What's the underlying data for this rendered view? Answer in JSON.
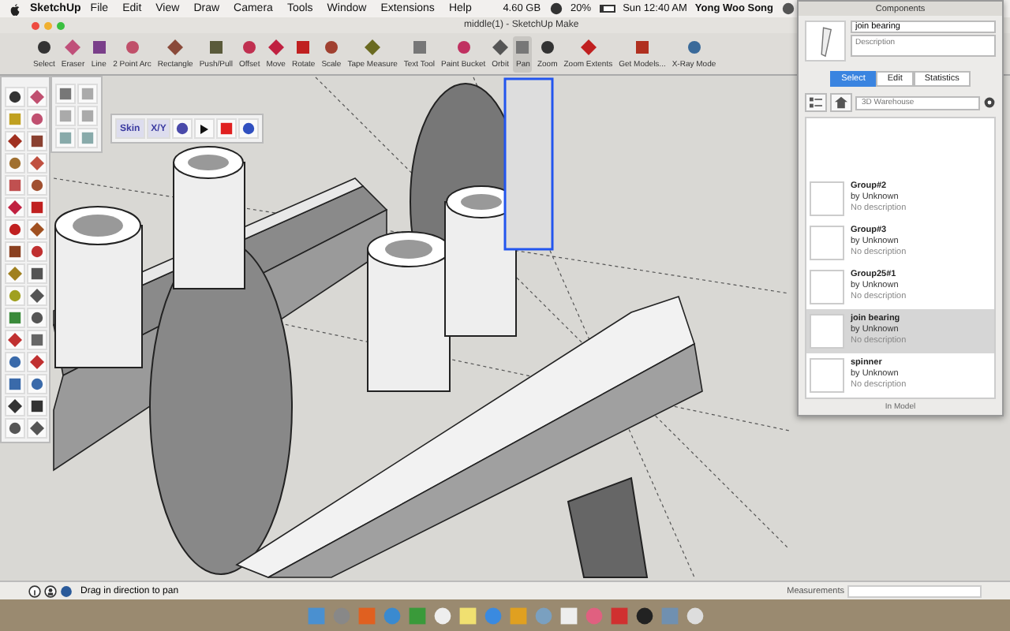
{
  "menu_bar": {
    "app": "SketchUp",
    "items": [
      "File",
      "Edit",
      "View",
      "Draw",
      "Camera",
      "Tools",
      "Window",
      "Extensions",
      "Help"
    ],
    "status": {
      "memory": "4.60 GB",
      "battery": "20%",
      "clock": "Sun 12:40 AM",
      "user": "Yong Woo Song"
    }
  },
  "window": {
    "title": "middle(1) - SketchUp Make"
  },
  "toolbar": [
    {
      "label": "Select",
      "selected": false
    },
    {
      "label": "Eraser",
      "selected": false
    },
    {
      "label": "Line",
      "selected": false
    },
    {
      "label": "2 Point Arc",
      "selected": false
    },
    {
      "label": "Rectangle",
      "selected": false
    },
    {
      "label": "Push/Pull",
      "selected": false
    },
    {
      "label": "Offset",
      "selected": false
    },
    {
      "label": "Move",
      "selected": false
    },
    {
      "label": "Rotate",
      "selected": false
    },
    {
      "label": "Scale",
      "selected": false
    },
    {
      "label": "Tape Measure",
      "selected": false
    },
    {
      "label": "Text Tool",
      "selected": false
    },
    {
      "label": "Paint Bucket",
      "selected": false
    },
    {
      "label": "Orbit",
      "selected": false
    },
    {
      "label": "Pan",
      "selected": true
    },
    {
      "label": "Zoom",
      "selected": false
    },
    {
      "label": "Zoom Extents",
      "selected": false
    },
    {
      "label": "Get Models...",
      "selected": false
    },
    {
      "label": "X-Ray Mode",
      "selected": false
    }
  ],
  "sandbox_toolbar": [
    "Skin",
    "X/Y"
  ],
  "components": {
    "title": "Components",
    "name": "join bearing",
    "description_placeholder": "Description",
    "tabs": [
      {
        "label": "Select",
        "selected": true
      },
      {
        "label": "Edit",
        "selected": false
      },
      {
        "label": "Statistics",
        "selected": false
      }
    ],
    "search_placeholder": "3D Warehouse",
    "items": [
      {
        "name": "Group#2",
        "author": "by Unknown",
        "description": "No description",
        "selected": false
      },
      {
        "name": "Group#3",
        "author": "by Unknown",
        "description": "No description",
        "selected": false
      },
      {
        "name": "Group25#1",
        "author": "by Unknown",
        "description": "No description",
        "selected": false
      },
      {
        "name": "join bearing",
        "author": "by Unknown",
        "description": "No description",
        "selected": true
      },
      {
        "name": "spinner",
        "author": "by Unknown",
        "description": "No description",
        "selected": false
      }
    ],
    "footer": "In Model"
  },
  "status_bar": {
    "hint": "Drag in direction to pan",
    "measurements_label": "Measurements"
  }
}
